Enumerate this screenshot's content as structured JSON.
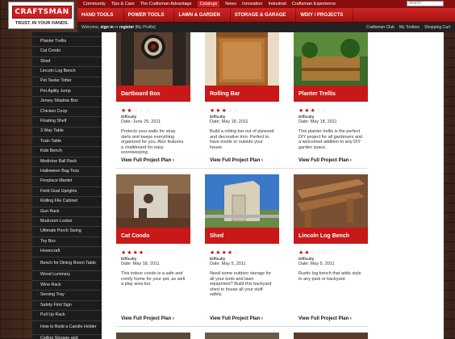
{
  "brand": {
    "logo_text": "CRAFTSMAN",
    "tagline": "TRUST. IN YOUR HANDS."
  },
  "top_nav": [
    {
      "label": "Community",
      "active": false
    },
    {
      "label": "Tips & Care",
      "active": false
    },
    {
      "label": "The Craftsman Advantage",
      "active": false
    },
    {
      "label": "Catalogs",
      "active": true
    },
    {
      "label": "News",
      "active": false
    },
    {
      "label": "Innovation",
      "active": false
    },
    {
      "label": "Industrial",
      "active": false
    },
    {
      "label": "Craftsman Experience",
      "active": false
    }
  ],
  "search": {
    "placeholder": "search"
  },
  "main_nav": [
    "HAND TOOLS",
    "POWER TOOLS",
    "LAWN & GARDEN",
    "STORAGE & GARAGE",
    "WDIY / PROJECTS"
  ],
  "sub_bar": {
    "welcome_prefix": "Welcome,",
    "sign_in": "sign in",
    "or": "or",
    "register": "register",
    "my_profile": "[My Profile]",
    "links": [
      "Craftsman Club",
      "My Toolbox",
      "Shopping Cart"
    ]
  },
  "sidebar": {
    "items": [
      "",
      "Planter Trellis",
      "Cat Condo",
      "Shed",
      "Lincoln Log Bench",
      "Pet Teeter Totter",
      "Pet Agility Jump",
      "Jersey Shadow Box",
      "Chicken Coop",
      "Floating Shelf",
      "3 Way Table",
      "Train Table",
      "Kids Bench",
      "Medicine Ball Rack",
      "Halloween Bag Toss",
      "Fireplace Mantel",
      "Field Goal Uprights",
      "Rolling File Cabinet",
      "Gun Rack",
      "Mudroom Locker",
      "Ultimate Porch Swing",
      "Toy Box",
      "Hovercraft",
      "Bench for Dining Room Table",
      "Wood Luminary",
      "Wine Rack",
      "Serving Tray",
      "Safety First Sign",
      "Pull Up Rack",
      "How to Build a Candle Holder",
      "Ceiling Storage and"
    ]
  },
  "cards": [
    {
      "title": "Dartboard Box",
      "rating": 2,
      "difficulty_label": "Difficulty",
      "date": "Date: June 29, 2011",
      "description": "Protects your walls for stray darts and keeps everything organized for you. Also features a chalkboard for easy scorekeeping.",
      "link": "View Full Project Plan ›"
    },
    {
      "title": "Rolling Bar",
      "rating": 3,
      "difficulty_label": "Difficulty",
      "date": "Date: May 18, 2011",
      "description": "Build a rolling bar out of plywood and decorative trim. Perfect to have inside or outside your house.",
      "link": "View Full Project Plan ›"
    },
    {
      "title": "Planter Trellis",
      "rating": 3,
      "difficulty_label": "Difficulty",
      "date": "Date: May 18, 2011",
      "description": "This planter trellis is the perfect DIY project for all gardeners and a welcomed addition to any DIY garden space.",
      "link": "View Full Project Plan ›"
    },
    {
      "title": "Cat Condo",
      "rating": 4,
      "difficulty_label": "Difficulty",
      "date": "Date: May 18, 2011",
      "description": "This indoor condo is a safe and comfy home for your pet, as well a play area too.",
      "link": "View Full Project Plan ›"
    },
    {
      "title": "Shed",
      "rating": 4,
      "difficulty_label": "Difficulty",
      "date": "Date: May 5, 2011",
      "description": "Need some outdoor storage for all your tools and lawn equipment? Build this backyard shed to house all your stuff safely.",
      "link": "View Full Project Plan ›"
    },
    {
      "title": "Lincoln Log Bench",
      "rating": 2,
      "difficulty_label": "Difficulty",
      "date": "Date: May 5, 2011",
      "description": "Rustic log bench that adds style to any park or backyard.",
      "link": "View Full Project Plan ›"
    }
  ],
  "colors": {
    "brand_red": "#c81818",
    "nav_dark_red": "#8a0d0d",
    "sidebar_bg": "#1c1c1c",
    "star_on": "#b81414"
  }
}
